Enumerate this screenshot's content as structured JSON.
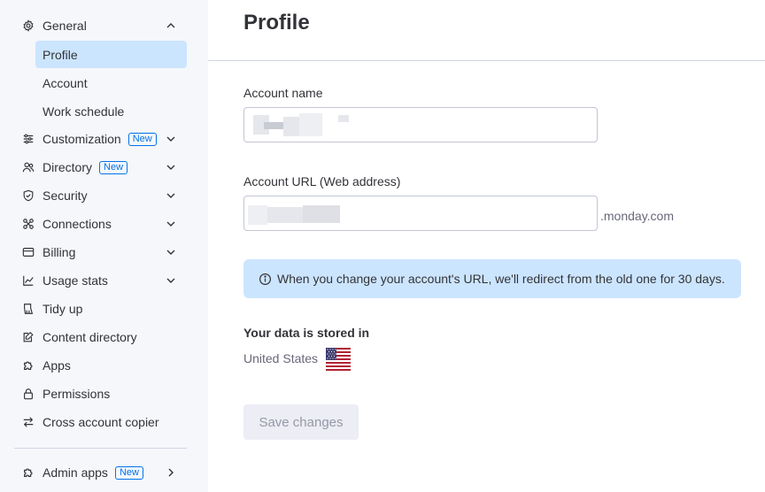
{
  "sidebar": {
    "general": {
      "label": "General",
      "icon": "gear-icon"
    },
    "sub_items": [
      {
        "label": "Profile",
        "active": true
      },
      {
        "label": "Account",
        "active": false
      },
      {
        "label": "Work schedule",
        "active": false
      }
    ],
    "items": [
      {
        "label": "Customization",
        "icon": "sliders-icon",
        "badge": "New",
        "chevron": "down"
      },
      {
        "label": "Directory",
        "icon": "users-icon",
        "badge": "New",
        "chevron": "down"
      },
      {
        "label": "Security",
        "icon": "shield-icon",
        "chevron": "down"
      },
      {
        "label": "Connections",
        "icon": "connections-icon",
        "chevron": "down"
      },
      {
        "label": "Billing",
        "icon": "credit-card-icon",
        "chevron": "down"
      },
      {
        "label": "Usage stats",
        "icon": "chart-icon",
        "chevron": "down"
      },
      {
        "label": "Tidy up",
        "icon": "broom-icon"
      },
      {
        "label": "Content directory",
        "icon": "document-edit-icon"
      },
      {
        "label": "Apps",
        "icon": "puzzle-icon"
      },
      {
        "label": "Permissions",
        "icon": "lock-icon"
      },
      {
        "label": "Cross account copier",
        "icon": "arrows-swap-icon"
      }
    ],
    "admin_apps": {
      "label": "Admin apps",
      "icon": "puzzle-icon",
      "badge": "New",
      "chevron": "right"
    }
  },
  "main": {
    "title": "Profile",
    "account_name_label": "Account name",
    "account_url_label": "Account URL (Web address)",
    "url_suffix": ".monday.com",
    "info_text": "When you change your account's URL, we'll redirect from the old one for 30 days.",
    "stored_title": "Your data is stored in",
    "country": "United States",
    "save_label": "Save changes"
  },
  "colors": {
    "accent": "#0073ea",
    "active_bg": "#cce5ff",
    "sidebar_bg": "#f6f7fb",
    "disabled_button_bg": "#ecedf5"
  }
}
